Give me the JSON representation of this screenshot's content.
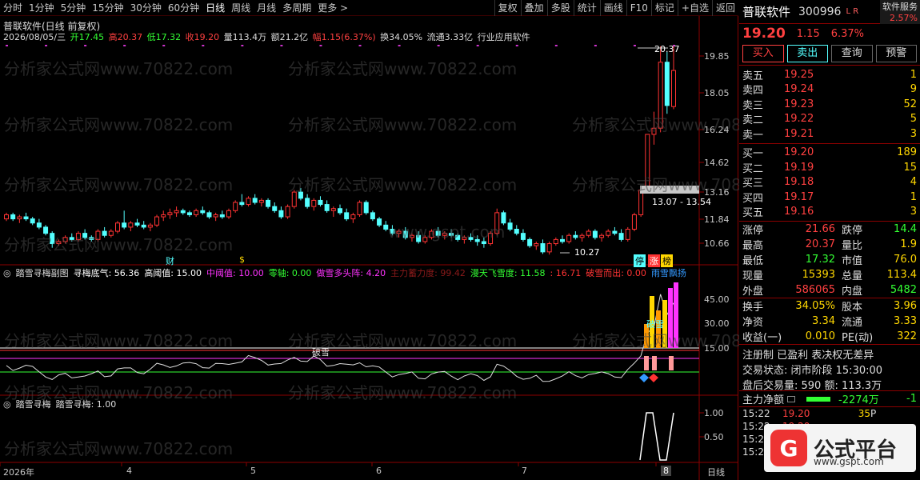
{
  "toolbar": {
    "periods": [
      "分时",
      "1分钟",
      "5分钟",
      "15分钟",
      "30分钟",
      "60分钟",
      "日线",
      "周线",
      "月线",
      "多周期",
      "更多 >"
    ],
    "active_period": "日线",
    "actions": [
      "复权",
      "叠加",
      "多股",
      "统计",
      "画线",
      "F10",
      "标记",
      "+自选",
      "返回"
    ]
  },
  "chart": {
    "title": "普联软件(日线 前复权)",
    "ohlc": {
      "date": "2026/08/05/三",
      "open_label": "开",
      "open": "17.45",
      "high_label": "高",
      "high": "20.37",
      "low_label": "低",
      "low": "17.32",
      "close_label": "收",
      "close": "19.20",
      "vol_label": "量",
      "vol": "113.4万",
      "amt_label": "额",
      "amt": "21.2亿",
      "chg_label": "幅",
      "chg": "1.15(6.37%)",
      "turnover_label": "换",
      "turnover": "34.05%",
      "float_label": "流通",
      "float": "3.33亿",
      "industry": "行业应用软件"
    },
    "y_ticks": [
      "19.85",
      "18.05",
      "16.24",
      "14.62",
      "13.16",
      "11.84",
      "10.66"
    ],
    "high_mark": "20.37",
    "low_mark": "10.27",
    "range_mark": "13.07 - 13.54",
    "event_tags": [
      "财",
      "$"
    ],
    "right_tags": [
      "停",
      "涨",
      "榜"
    ],
    "colors": {
      "up": "#ff3333",
      "down": "#54ffff",
      "ma": "#ffffff"
    }
  },
  "chart_data": {
    "type": "candlestick",
    "x_labels": [
      "2026年",
      "4",
      "5",
      "6",
      "7",
      "8"
    ],
    "y_range": [
      10.2,
      20.6
    ],
    "candles": [
      [
        12.0,
        12.3,
        11.9,
        12.2
      ],
      [
        12.2,
        12.3,
        11.9,
        12.0
      ],
      [
        12.0,
        12.2,
        11.8,
        12.1
      ],
      [
        12.1,
        12.3,
        11.9,
        12.0
      ],
      [
        12.0,
        12.1,
        11.7,
        11.8
      ],
      [
        11.8,
        12.0,
        11.5,
        11.6
      ],
      [
        11.6,
        11.7,
        11.2,
        11.3
      ],
      [
        11.3,
        11.4,
        10.6,
        10.8
      ],
      [
        10.8,
        11.0,
        10.7,
        10.9
      ],
      [
        10.9,
        11.2,
        10.8,
        11.1
      ],
      [
        11.1,
        11.3,
        10.9,
        11.0
      ],
      [
        11.0,
        11.4,
        10.9,
        11.3
      ],
      [
        11.3,
        11.5,
        11.0,
        11.1
      ],
      [
        11.1,
        11.2,
        10.9,
        11.0
      ],
      [
        11.0,
        11.5,
        10.9,
        11.4
      ],
      [
        11.4,
        11.6,
        11.1,
        11.2
      ],
      [
        11.2,
        11.5,
        11.1,
        11.4
      ],
      [
        11.4,
        11.9,
        11.3,
        11.8
      ],
      [
        11.8,
        12.4,
        11.5,
        11.6
      ],
      [
        11.6,
        11.9,
        11.4,
        11.8
      ],
      [
        11.8,
        12.0,
        11.6,
        11.7
      ],
      [
        11.7,
        11.9,
        11.5,
        11.6
      ],
      [
        11.6,
        11.8,
        11.4,
        11.7
      ],
      [
        11.7,
        12.2,
        11.6,
        12.1
      ],
      [
        12.1,
        12.4,
        11.9,
        12.2
      ],
      [
        12.2,
        12.5,
        12.0,
        12.3
      ],
      [
        12.3,
        12.6,
        12.1,
        12.4
      ],
      [
        12.4,
        12.5,
        12.2,
        12.3
      ],
      [
        12.3,
        12.4,
        12.1,
        12.2
      ],
      [
        12.2,
        12.5,
        12.1,
        12.4
      ],
      [
        12.4,
        12.6,
        12.2,
        12.3
      ],
      [
        12.3,
        12.4,
        12.0,
        12.1
      ],
      [
        12.1,
        12.3,
        11.9,
        12.2
      ],
      [
        12.2,
        12.4,
        12.0,
        12.1
      ],
      [
        12.1,
        12.5,
        12.0,
        12.4
      ],
      [
        12.4,
        12.9,
        12.3,
        12.8
      ],
      [
        12.8,
        13.2,
        12.6,
        12.7
      ],
      [
        12.7,
        13.1,
        12.6,
        13.0
      ],
      [
        13.0,
        13.2,
        12.7,
        12.8
      ],
      [
        12.8,
        13.0,
        12.6,
        12.9
      ],
      [
        12.9,
        13.0,
        12.5,
        12.6
      ],
      [
        12.6,
        12.8,
        12.3,
        12.4
      ],
      [
        12.4,
        12.6,
        12.0,
        12.1
      ],
      [
        12.1,
        12.7,
        12.0,
        12.6
      ],
      [
        12.6,
        13.4,
        12.5,
        13.3
      ],
      [
        13.3,
        13.5,
        12.9,
        13.0
      ],
      [
        13.0,
        13.2,
        12.5,
        12.6
      ],
      [
        12.6,
        13.0,
        12.4,
        12.9
      ],
      [
        12.9,
        13.1,
        12.6,
        12.7
      ],
      [
        12.7,
        12.9,
        12.3,
        12.4
      ],
      [
        12.4,
        12.6,
        12.1,
        12.5
      ],
      [
        12.5,
        12.7,
        12.2,
        12.3
      ],
      [
        12.3,
        12.5,
        11.9,
        12.0
      ],
      [
        12.0,
        12.3,
        11.8,
        12.2
      ],
      [
        12.2,
        12.9,
        12.1,
        12.8
      ],
      [
        12.8,
        12.9,
        12.2,
        12.3
      ],
      [
        12.3,
        12.4,
        11.9,
        12.0
      ],
      [
        12.0,
        12.1,
        11.6,
        11.7
      ],
      [
        11.7,
        11.9,
        11.4,
        11.5
      ],
      [
        11.5,
        11.7,
        11.2,
        11.3
      ],
      [
        11.3,
        11.5,
        11.1,
        11.4
      ],
      [
        11.4,
        11.6,
        11.0,
        11.1
      ],
      [
        11.1,
        11.3,
        10.9,
        11.2
      ],
      [
        11.2,
        11.4,
        10.8,
        10.9
      ],
      [
        10.9,
        11.2,
        10.8,
        11.1
      ],
      [
        11.1,
        11.5,
        11.0,
        11.4
      ],
      [
        11.4,
        11.6,
        11.1,
        11.2
      ],
      [
        11.2,
        11.4,
        11.0,
        11.3
      ],
      [
        11.3,
        11.5,
        11.1,
        11.2
      ],
      [
        11.2,
        11.3,
        10.9,
        11.0
      ],
      [
        11.0,
        11.2,
        10.8,
        11.1
      ],
      [
        11.1,
        11.3,
        10.9,
        11.0
      ],
      [
        11.0,
        11.2,
        10.7,
        10.9
      ],
      [
        10.9,
        11.1,
        10.6,
        10.8
      ],
      [
        10.8,
        11.4,
        10.7,
        11.3
      ],
      [
        11.3,
        12.5,
        11.2,
        12.3
      ],
      [
        12.3,
        12.4,
        11.7,
        11.8
      ],
      [
        11.8,
        12.0,
        11.4,
        11.5
      ],
      [
        11.5,
        11.7,
        11.2,
        11.3
      ],
      [
        11.3,
        11.5,
        10.9,
        11.0
      ],
      [
        11.0,
        11.1,
        10.6,
        10.7
      ],
      [
        10.7,
        10.9,
        10.5,
        10.8
      ],
      [
        10.8,
        11.0,
        10.3,
        10.4
      ],
      [
        10.4,
        10.9,
        10.27,
        10.8
      ],
      [
        10.8,
        11.1,
        10.7,
        11.0
      ],
      [
        11.0,
        11.2,
        10.8,
        10.9
      ],
      [
        10.9,
        11.3,
        10.8,
        11.2
      ],
      [
        11.2,
        11.4,
        11.0,
        11.1
      ],
      [
        11.1,
        11.3,
        10.9,
        11.2
      ],
      [
        11.2,
        11.5,
        11.1,
        11.4
      ],
      [
        11.4,
        11.5,
        11.0,
        11.1
      ],
      [
        11.1,
        11.3,
        10.9,
        11.2
      ],
      [
        11.2,
        11.5,
        11.1,
        11.4
      ],
      [
        11.4,
        11.6,
        11.2,
        11.3
      ],
      [
        11.3,
        11.5,
        10.9,
        11.0
      ],
      [
        11.0,
        11.6,
        10.9,
        11.5
      ],
      [
        11.5,
        12.3,
        11.4,
        12.2
      ],
      [
        12.2,
        13.4,
        12.1,
        13.4
      ],
      [
        13.4,
        16.1,
        13.4,
        16.1
      ],
      [
        16.1,
        17.2,
        15.6,
        16.4
      ],
      [
        16.4,
        20.37,
        16.2,
        19.6
      ],
      [
        19.6,
        20.1,
        17.1,
        17.5
      ],
      [
        17.45,
        20.37,
        17.32,
        19.2
      ]
    ],
    "ind1": {
      "name": "踏雪寻梅副图",
      "series": {
        "寻梅底气": 56.36,
        "高阈值": 15.0,
        "中阈值": 10.0,
        "零轴": 0.0,
        "做雪多头阵": 4.2,
        "主力蓄力度": 99.42,
        "漫天飞雪度": 11.58,
        "破雪而出": 16.71
      },
      "y_ticks": [
        "45.00",
        "30.00",
        "15.00"
      ]
    },
    "ind2": {
      "name": "踏雪寻梅",
      "value": 1.0,
      "y_ticks": [
        "1.00",
        "0.50"
      ]
    }
  },
  "ind1_title": {
    "name": "踏雪寻梅副图",
    "items": [
      {
        "label": "寻梅底气: 56.36",
        "color": "#ffffff"
      },
      {
        "label": "高阈值: 15.00",
        "color": "#ffffff"
      },
      {
        "label": "中阈值: 10.00",
        "color": "#ff33ff"
      },
      {
        "label": "零轴: 0.00",
        "color": "#33ff33"
      },
      {
        "label": "做雪多头阵: 4.20",
        "color": "#ff33ff"
      },
      {
        "label": "主力蓄力度: 99.42",
        "color": "#8b1a1a"
      },
      {
        "label": "漫天飞雪度: 11.58",
        "color": "#33ff33"
      },
      {
        "label": ": 16.71",
        "color": "#ff3333"
      },
      {
        "label": "破雪而出: 0.00",
        "color": "#ff3333"
      },
      {
        "label": "雨雪飘扬",
        "color": "#3399ff"
      }
    ],
    "annot1": "破雪",
    "annot2": "破雪"
  },
  "ind2_title": {
    "name": "踏雪寻梅",
    "item": "踏雪寻梅: 1.00"
  },
  "x_axis": {
    "labels": [
      "2026年",
      "4",
      "5",
      "6",
      "7",
      "8"
    ],
    "period": "日线"
  },
  "watermark": "分析家公式网www.70822.com",
  "watermark2": "www.gspt.com",
  "side": {
    "name": "普联软件",
    "code": "300996",
    "lr": "L R",
    "tag": "软件服务",
    "tag_pct": "2.57%",
    "price": "19.20",
    "chg": "1.15",
    "pct": "6.37%",
    "buttons": [
      "买入",
      "卖出",
      "查询",
      "预警"
    ],
    "asks": [
      {
        "l": "卖五",
        "p": "19.25",
        "v": "1"
      },
      {
        "l": "卖四",
        "p": "19.24",
        "v": "9"
      },
      {
        "l": "卖三",
        "p": "19.23",
        "v": "52"
      },
      {
        "l": "卖二",
        "p": "19.22",
        "v": "5"
      },
      {
        "l": "卖一",
        "p": "19.21",
        "v": "3"
      }
    ],
    "bids": [
      {
        "l": "买一",
        "p": "19.20",
        "v": "189"
      },
      {
        "l": "买二",
        "p": "19.19",
        "v": "15"
      },
      {
        "l": "买三",
        "p": "19.18",
        "v": "4"
      },
      {
        "l": "买四",
        "p": "19.17",
        "v": "1"
      },
      {
        "l": "买五",
        "p": "19.16",
        "v": "3"
      }
    ],
    "stats": [
      {
        "k": "涨停",
        "v1": "21.66",
        "k2": "跌停",
        "v2": "14.4"
      },
      {
        "k": "最高",
        "v1": "20.37",
        "k2": "量比",
        "v2": "1.9"
      },
      {
        "k": "最低",
        "v1": "17.32",
        "k2": "市值",
        "v2": "76.0"
      },
      {
        "k": "现量",
        "v1": "15393",
        "k2": "总量",
        "v2": "113.4"
      },
      {
        "k": "外盘",
        "v1": "586065",
        "k2": "内盘",
        "v2": "5482"
      }
    ],
    "fin": [
      {
        "k": "换手",
        "v1": "34.05%",
        "k2": "股本",
        "v2": "3.96"
      },
      {
        "k": "净资",
        "v1": "3.34",
        "k2": "流通",
        "v2": "3.33"
      },
      {
        "k": "收益(一)",
        "v1": "0.010",
        "k2": "PE(动)",
        "v2": "322"
      }
    ],
    "reg": "注册制 已盈利 表决权无差异",
    "trade_status": "交易状态: 闭市阶段 15:30:00",
    "after": "盘后交易量: 590  额: 113.3万",
    "main_flow_label": "主力净额",
    "main_flow": "-2274万",
    "main_flow2": "-1",
    "ticks": [
      {
        "t": "15:22",
        "p": "19.20",
        "v": "35",
        "d": "P"
      },
      {
        "t": "15:22",
        "p": "19.20",
        "v": "",
        "d": ""
      },
      {
        "t": "15:22",
        "p": "19.20",
        "v": "",
        "d": ""
      },
      {
        "t": "15:23",
        "p": "19.20",
        "v": "",
        "d": ""
      }
    ]
  },
  "logo": {
    "mark": "G",
    "text": "公式平台",
    "url": "www.gspt.com"
  }
}
